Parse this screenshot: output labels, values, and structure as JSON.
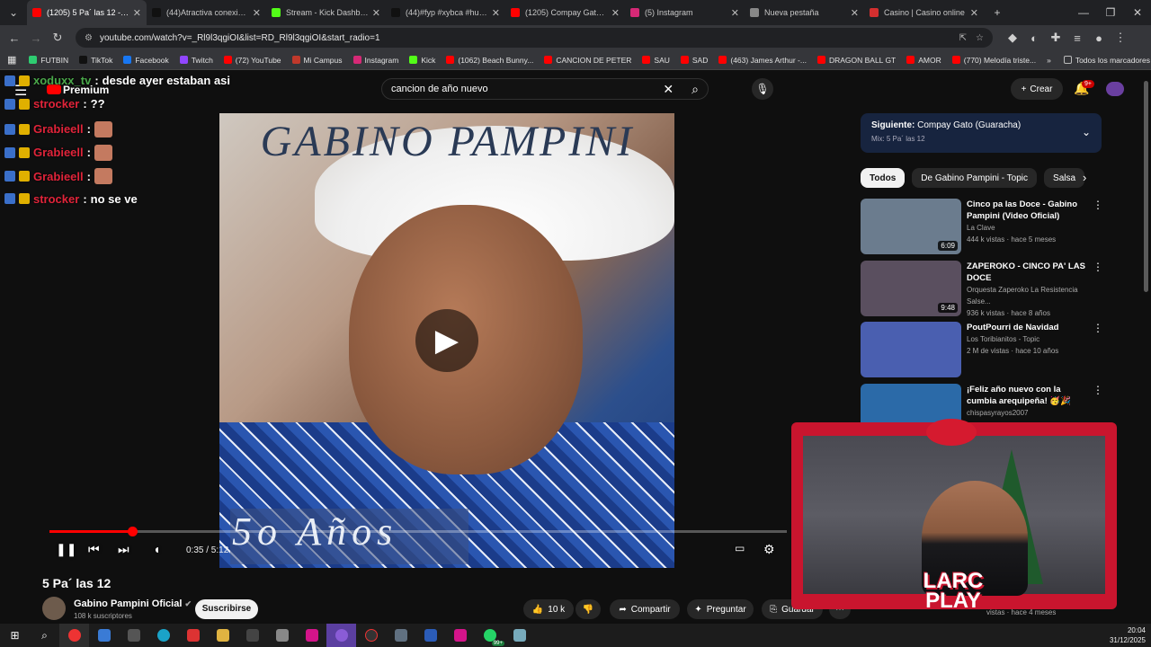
{
  "browser": {
    "tabs": [
      {
        "title": "(1205) 5 Pa´ las 12 - YouTube",
        "color": "#ff0000",
        "active": true
      },
      {
        "title": "(44)Atractiva conexión en",
        "color": "#111111"
      },
      {
        "title": "Stream - Kick Dashboard",
        "color": "#53fc18"
      },
      {
        "title": "(44)#fyp #xybca #humor",
        "color": "#111111"
      },
      {
        "title": "(1205) Compay Gato (Gu",
        "color": "#ff0000"
      },
      {
        "title": "(5) Instagram",
        "color": "#d62976"
      },
      {
        "title": "Nueva pestaña",
        "color": "#888888"
      },
      {
        "title": "Casino | Casino online",
        "color": "#d32f2f"
      }
    ],
    "url": "youtube.com/watch?v=_Rl9l3qgiOI&list=RD_Rl9l3qgiOI&start_radio=1",
    "bookmarks": [
      {
        "label": "FUTBIN",
        "color": "#2ecc71"
      },
      {
        "label": "TikTok",
        "color": "#111111"
      },
      {
        "label": "Facebook",
        "color": "#1877f2"
      },
      {
        "label": "Twitch",
        "color": "#9146ff"
      },
      {
        "label": "(72) YouTube",
        "color": "#ff0000"
      },
      {
        "label": "Mi Campus",
        "color": "#c0392b"
      },
      {
        "label": "Instagram",
        "color": "#d62976"
      },
      {
        "label": "Kick",
        "color": "#53fc18"
      },
      {
        "label": "(1062) Beach Bunny...",
        "color": "#ff0000"
      },
      {
        "label": "CANCION DE PETER",
        "color": "#ff0000"
      },
      {
        "label": "SAU",
        "color": "#ff0000"
      },
      {
        "label": "SAD",
        "color": "#ff0000"
      },
      {
        "label": "(463) James Arthur -...",
        "color": "#ff0000"
      },
      {
        "label": "DRAGON BALL GT",
        "color": "#ff0000"
      },
      {
        "label": "AMOR",
        "color": "#ff0000"
      },
      {
        "label": "(770) Melodía triste...",
        "color": "#ff0000"
      }
    ],
    "all_bookmarks": "Todos los marcadores"
  },
  "youtube": {
    "logo_text": "Premium",
    "search_value": "cancion de año nuevo",
    "create_label": "Crear",
    "notif_badge": "9+"
  },
  "chat": [
    {
      "user": "xoduxx_tv",
      "msg": "desde ayer estaban asi",
      "color": "#4aa84a"
    },
    {
      "user": "strocker",
      "msg": "??",
      "color": "#e0243a"
    },
    {
      "user": "Grabieell",
      "msg": "",
      "color": "#e0243a"
    },
    {
      "user": "Grabieell",
      "msg": "",
      "color": "#e0243a"
    },
    {
      "user": "Grabieell",
      "msg": "",
      "color": "#e0243a"
    },
    {
      "user": "strocker",
      "msg": "no se ve",
      "color": "#e0243a"
    }
  ],
  "video": {
    "art_title": "GABINO PAMPINI",
    "art_subtitle": "5o Años",
    "time": "0:35 / 5:12",
    "progress_fraction": 0.112,
    "title": "5 Pa´ las 12",
    "channel": "Gabino Pampini Oficial",
    "subscribers": "108 k suscriptores",
    "subscribe_label": "Suscribirse",
    "likes": "10 k",
    "share_label": "Compartir",
    "ask_label": "Preguntar",
    "save_label": "Guardar"
  },
  "sidebar": {
    "up_next_prefix": "Siguiente:",
    "up_next_title": "Compay Gato (Guaracha)",
    "mix_label": "Mix: 5 Pa´ las 12",
    "chips": [
      "Todos",
      "De Gabino Pampini - Topic",
      "Salsa"
    ],
    "videos": [
      {
        "title": "Cinco pa las Doce - Gabino Pampini (Video Oficial)",
        "channel": "La Clave",
        "meta": "444 k vistas · hace 5 meses",
        "duration": "6:09",
        "color": "#6b7c8e"
      },
      {
        "title": "ZAPEROKO - CINCO PA' LAS DOCE",
        "channel": "Orquesta Zaperoko La Resistencia Salse...",
        "meta": "936 k vistas · hace 8 años",
        "duration": "9:48",
        "color": "#5a4f5f"
      },
      {
        "title": "PoutPourri de Navidad",
        "channel": "Los Toribianitos - Topic",
        "meta": "2 M de vistas · hace 10 años",
        "duration": "",
        "color": "#4a5fb0"
      },
      {
        "title": "¡Feliz año nuevo con la cumbia arequipeña! 🥳🎉",
        "channel": "chispasyrayos2007",
        "meta": "",
        "duration": "",
        "color": "#2b6aa8"
      }
    ],
    "partial_meta": "vistas · hace 4 meses"
  },
  "overlay": {
    "brand_line1": "LARC",
    "brand_line2": "PLAY"
  },
  "taskbar": {
    "time": "20:04",
    "date": "31/12/2025",
    "badge": "99+"
  }
}
